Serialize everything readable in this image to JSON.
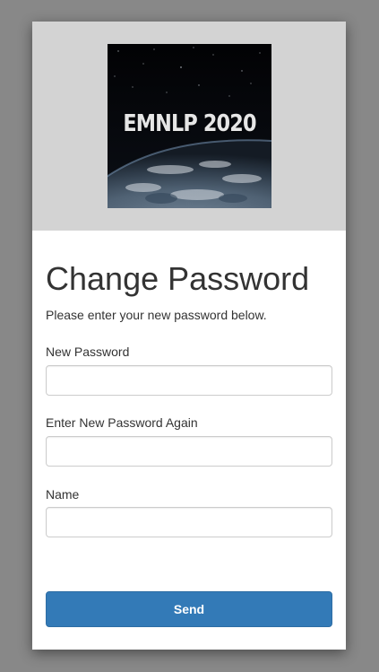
{
  "logo": {
    "text": "EMNLP 2020",
    "image_description_name": "earth-from-space-logo"
  },
  "form": {
    "title": "Change Password",
    "subtitle": "Please enter your new password below.",
    "fields": [
      {
        "label": "New Password",
        "value": "",
        "placeholder": ""
      },
      {
        "label": "Enter New Password Again",
        "value": "",
        "placeholder": ""
      },
      {
        "label": "Name",
        "value": "",
        "placeholder": ""
      }
    ],
    "submit_label": "Send"
  },
  "colors": {
    "backdrop": "#888888",
    "header_bg": "#d3d3d3",
    "primary_button": "#337ab7"
  }
}
